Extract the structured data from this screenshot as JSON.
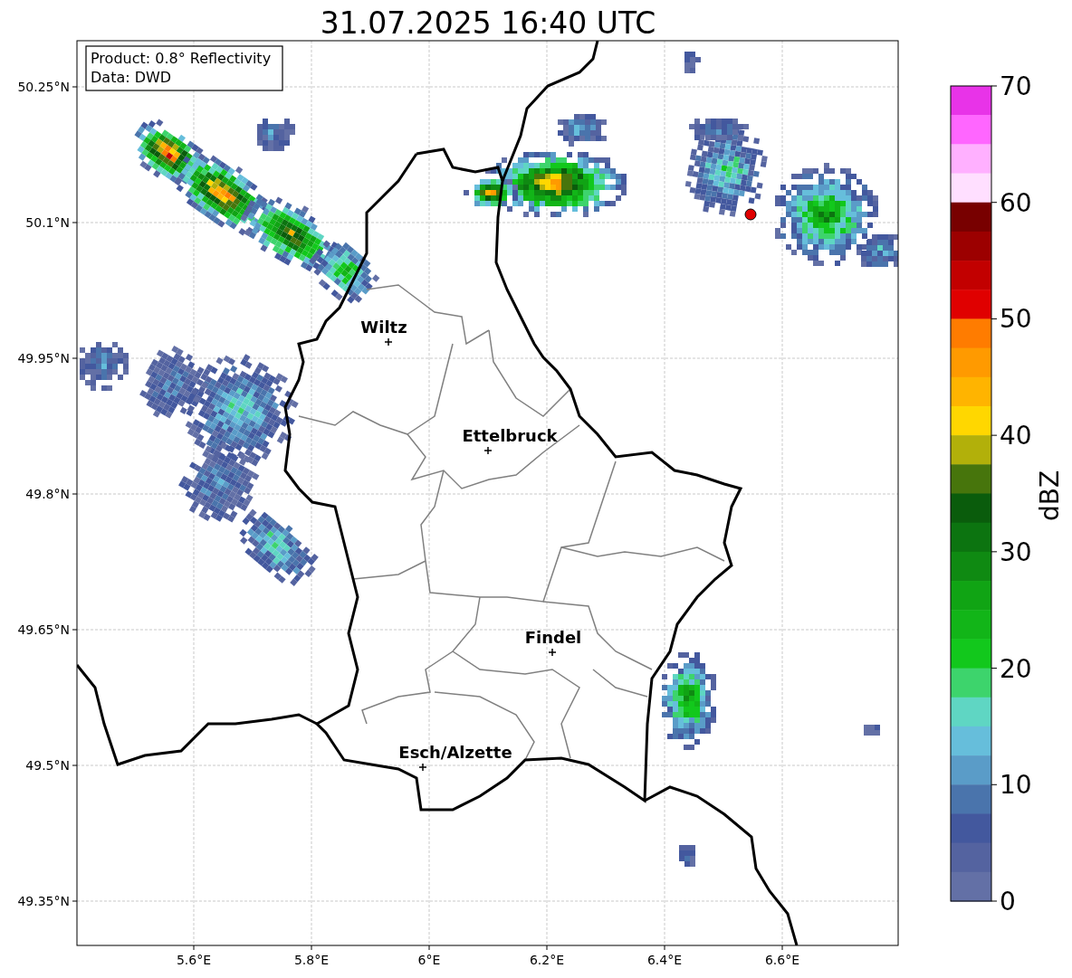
{
  "title": "31.07.2025 16:40 UTC",
  "info_box": [
    "Product: 0.8° Reflectivity",
    "Data: DWD"
  ],
  "map": {
    "x_ticks": [
      "5.6°E",
      "5.8°E",
      "6°E",
      "6.2°E",
      "6.4°E",
      "6.6°E"
    ],
    "y_ticks": [
      "50.25°N",
      "50.1°N",
      "49.95°N",
      "49.8°N",
      "49.65°N",
      "49.5°N",
      "49.35°N"
    ],
    "cities": [
      {
        "name": "Wiltz"
      },
      {
        "name": "Ettelbruck"
      },
      {
        "name": "Findel"
      },
      {
        "name": "Esch/Alzette"
      }
    ]
  },
  "colorbar": {
    "label": "dBZ",
    "ticks": [
      "70",
      "60",
      "50",
      "40",
      "30",
      "20",
      "10",
      "0"
    ],
    "segments": [
      {
        "color": "#e833e8"
      },
      {
        "color": "#ff66ff"
      },
      {
        "color": "#ffb0ff"
      },
      {
        "color": "#ffdfff"
      },
      {
        "color": "#780000"
      },
      {
        "color": "#9c0000"
      },
      {
        "color": "#c20000"
      },
      {
        "color": "#e00000"
      },
      {
        "color": "#ff7c00"
      },
      {
        "color": "#ff9a00"
      },
      {
        "color": "#ffb400"
      },
      {
        "color": "#ffd700"
      },
      {
        "color": "#b2b00a"
      },
      {
        "color": "#47750c"
      },
      {
        "color": "#0a5c0c"
      },
      {
        "color": "#0c7410"
      },
      {
        "color": "#0f8a12"
      },
      {
        "color": "#10a414"
      },
      {
        "color": "#12b518"
      },
      {
        "color": "#12c81c"
      },
      {
        "color": "#3dd46c"
      },
      {
        "color": "#5fd6c3"
      },
      {
        "color": "#66bedb"
      },
      {
        "color": "#5a9cc8"
      },
      {
        "color": "#4a74ac"
      },
      {
        "color": "#43589e"
      },
      {
        "color": "#5463a0"
      },
      {
        "color": "#6370a6"
      }
    ]
  }
}
